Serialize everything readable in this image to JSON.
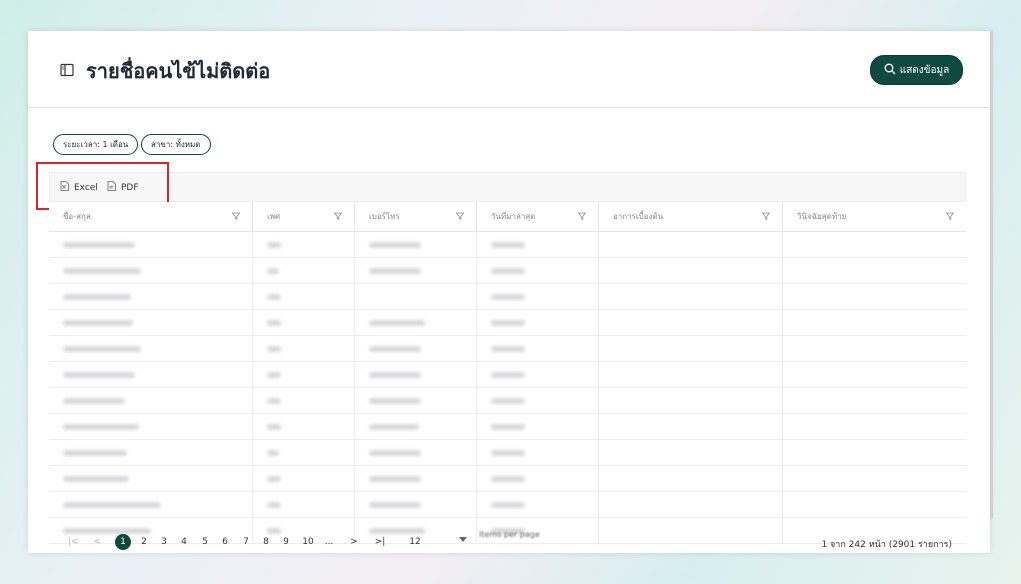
{
  "header": {
    "title": "รายชื่อคนไข้ไม่ติดต่อ",
    "show_button_label": "แสดงข้อมูล"
  },
  "filters": [
    {
      "label": "ระยะเวลา: 1 เดือน"
    },
    {
      "label": "สาขา: ทั้งหมด"
    }
  ],
  "toolbar": {
    "excel_label": "Excel",
    "pdf_label": "PDF"
  },
  "table": {
    "columns": [
      {
        "label": "ชื่อ-สกุล"
      },
      {
        "label": "เพศ"
      },
      {
        "label": "เบอร์โทร"
      },
      {
        "label": "วันที่มาล่าสุด"
      },
      {
        "label": "อาการเบื้องต้น"
      },
      {
        "label": "วินิจฉัยสุดท้าย"
      }
    ],
    "row_count": 12
  },
  "pagination": {
    "first": "|<",
    "prev": "<",
    "pages": [
      "1",
      "2",
      "3",
      "4",
      "5",
      "6",
      "7",
      "8",
      "9",
      "10",
      "..."
    ],
    "current": "1",
    "next": ">",
    "last": ">|",
    "page_size": "12",
    "page_size_label": "Items per page",
    "summary": "1 จาก 242 หน้า (2901 รายการ)"
  },
  "colors": {
    "brand": "#0e4a3f",
    "highlight": "#d9262c"
  }
}
